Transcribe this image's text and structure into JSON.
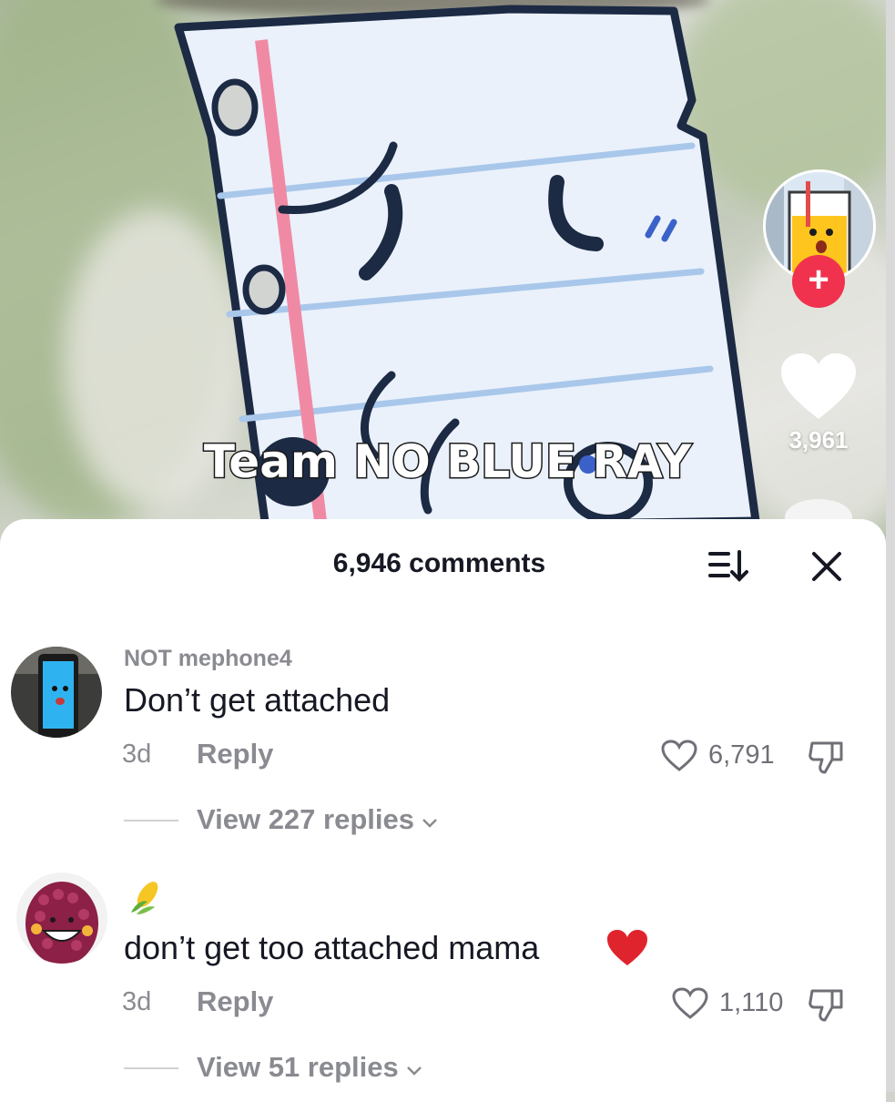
{
  "video": {
    "overlay_caption": "Team NO BLUE RAY",
    "like_count": "3,961",
    "rail_avatar_icon": "juice-glass-character-icon",
    "follow_icon": "plus-icon",
    "like_icon": "heart-icon"
  },
  "comments_sheet": {
    "title": "6,946 comments",
    "sort_icon": "sort-icon",
    "close_icon": "close-icon",
    "comments": [
      {
        "username": "NOT mephone4",
        "text": "Don’t get attached",
        "time": "3d",
        "reply_label": "Reply",
        "likes": "6,791",
        "view_replies": "View 227 replies",
        "avatar_icon": "phone-character-avatar"
      },
      {
        "username_emoji": "corn-emoji",
        "text": "don’t get too attached mama",
        "trailing_emoji": "red-heart-emoji",
        "time": "3d",
        "reply_label": "Reply",
        "likes": "1,110",
        "view_replies": "View 51 replies",
        "avatar_icon": "corn-character-avatar"
      }
    ]
  },
  "colors": {
    "accent_red": "#f0324f",
    "text_primary": "#161823",
    "text_secondary": "#8a8b91",
    "paper_blue_lines": "#a9c7ea",
    "paper_margin": "#f08aa4"
  }
}
